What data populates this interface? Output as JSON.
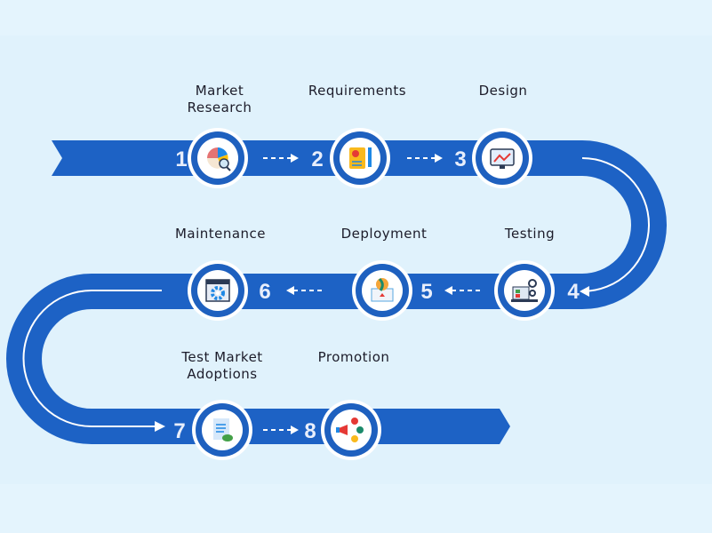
{
  "colors": {
    "background": "#e4f4fd",
    "band": "#1d62c5",
    "ring": "#1e60bf",
    "text": "#1c1c2a"
  },
  "steps": [
    {
      "number": "1",
      "label_lines": [
        "Market",
        "Research"
      ],
      "icon": "pie-chart-magnifier-icon"
    },
    {
      "number": "2",
      "label_lines": [
        "Requirements"
      ],
      "icon": "document-checklist-pencil-icon"
    },
    {
      "number": "3",
      "label_lines": [
        "Design"
      ],
      "icon": "design-monitor-icon"
    },
    {
      "number": "4",
      "label_lines": [
        "Testing"
      ],
      "icon": "testing-laptop-gears-icon"
    },
    {
      "number": "5",
      "label_lines": [
        "Deployment"
      ],
      "icon": "deployment-laptop-globe-icon"
    },
    {
      "number": "6",
      "label_lines": [
        "Maintenance"
      ],
      "icon": "maintenance-browser-gear-icon"
    },
    {
      "number": "7",
      "label_lines": [
        "Test Market",
        "Adoptions"
      ],
      "icon": "document-flask-icon"
    },
    {
      "number": "8",
      "label_lines": [
        "Promotion"
      ],
      "icon": "megaphone-promotion-icon"
    }
  ]
}
